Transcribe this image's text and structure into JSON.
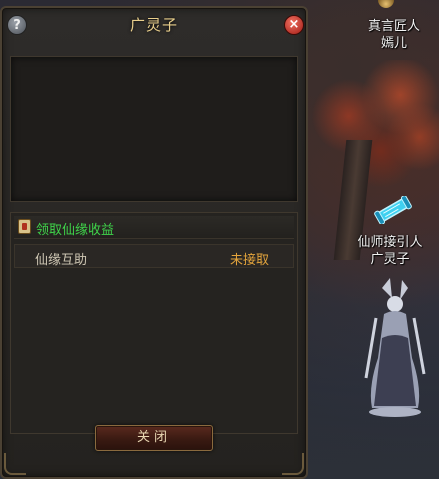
{
  "dialog": {
    "title": "广灵子",
    "help_label": "?",
    "close_icon_label": "×",
    "section_header": "领取仙缘收益",
    "tasks": [
      {
        "name": "仙缘互助",
        "status": "未接取"
      }
    ],
    "close_button_label": "关闭"
  },
  "scene": {
    "npc_top": {
      "line1": "真言匠人",
      "line2": "嫣儿"
    },
    "npc_mid": {
      "line1": "仙师接引人",
      "line2": "广灵子"
    }
  },
  "colors": {
    "title": "#e9cf8c",
    "header_green": "#3fd44a",
    "status_orange": "#e3a43c",
    "close_red": "#c0281c"
  },
  "icons": [
    "help-icon",
    "close-icon",
    "quest-badge-icon",
    "quest-scroll-icon"
  ]
}
